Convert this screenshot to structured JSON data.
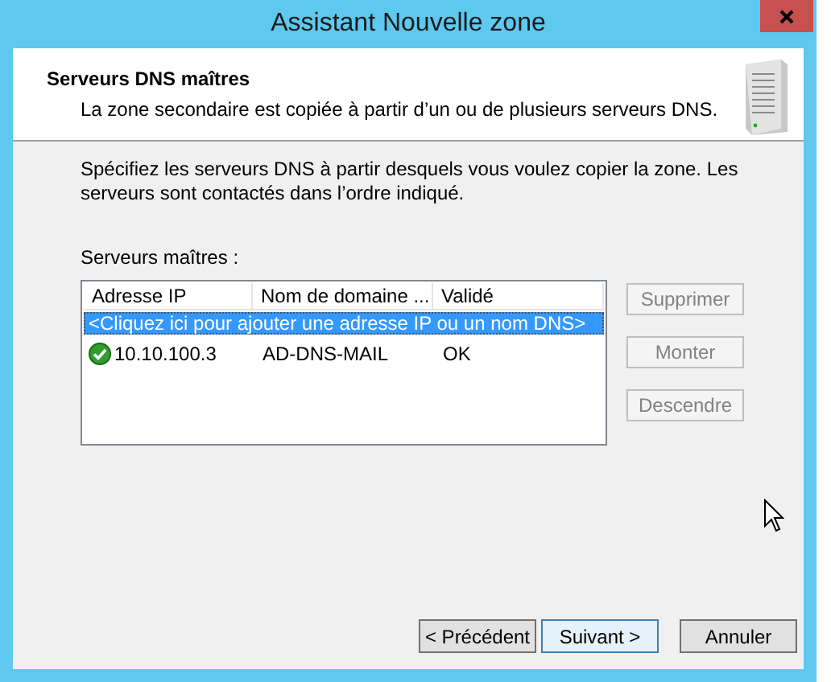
{
  "window": {
    "title": "Assistant Nouvelle zone"
  },
  "header": {
    "title": "Serveurs DNS maîtres",
    "subtitle": "La zone secondaire est copiée à partir d’un ou de plusieurs serveurs DNS."
  },
  "instructions": "Spécifiez les serveurs DNS à partir desquels vous voulez copier la zone. Les serveurs sont contactés dans l’ordre indiqué.",
  "list": {
    "label": "Serveurs maîtres :",
    "columns": [
      "Adresse IP",
      "Nom de domaine ...",
      "Validé"
    ],
    "add_row": {
      "text": "<Cliquez ici pour ajouter une adresse IP ou un nom DNS>",
      "selected": true
    },
    "rows": [
      {
        "valid": true,
        "cells": [
          "10.10.100.3",
          "AD-DNS-MAIL",
          "OK"
        ]
      }
    ]
  },
  "side_buttons": [
    {
      "label": "Supprimer",
      "disabled": true
    },
    {
      "label": "Monter",
      "disabled": true
    },
    {
      "label": "Descendre",
      "disabled": true
    }
  ],
  "footer_buttons": [
    {
      "label": "< Précédent",
      "default": false
    },
    {
      "label": "Suivant >",
      "default": true
    },
    {
      "label": "Annuler",
      "default": false
    }
  ]
}
